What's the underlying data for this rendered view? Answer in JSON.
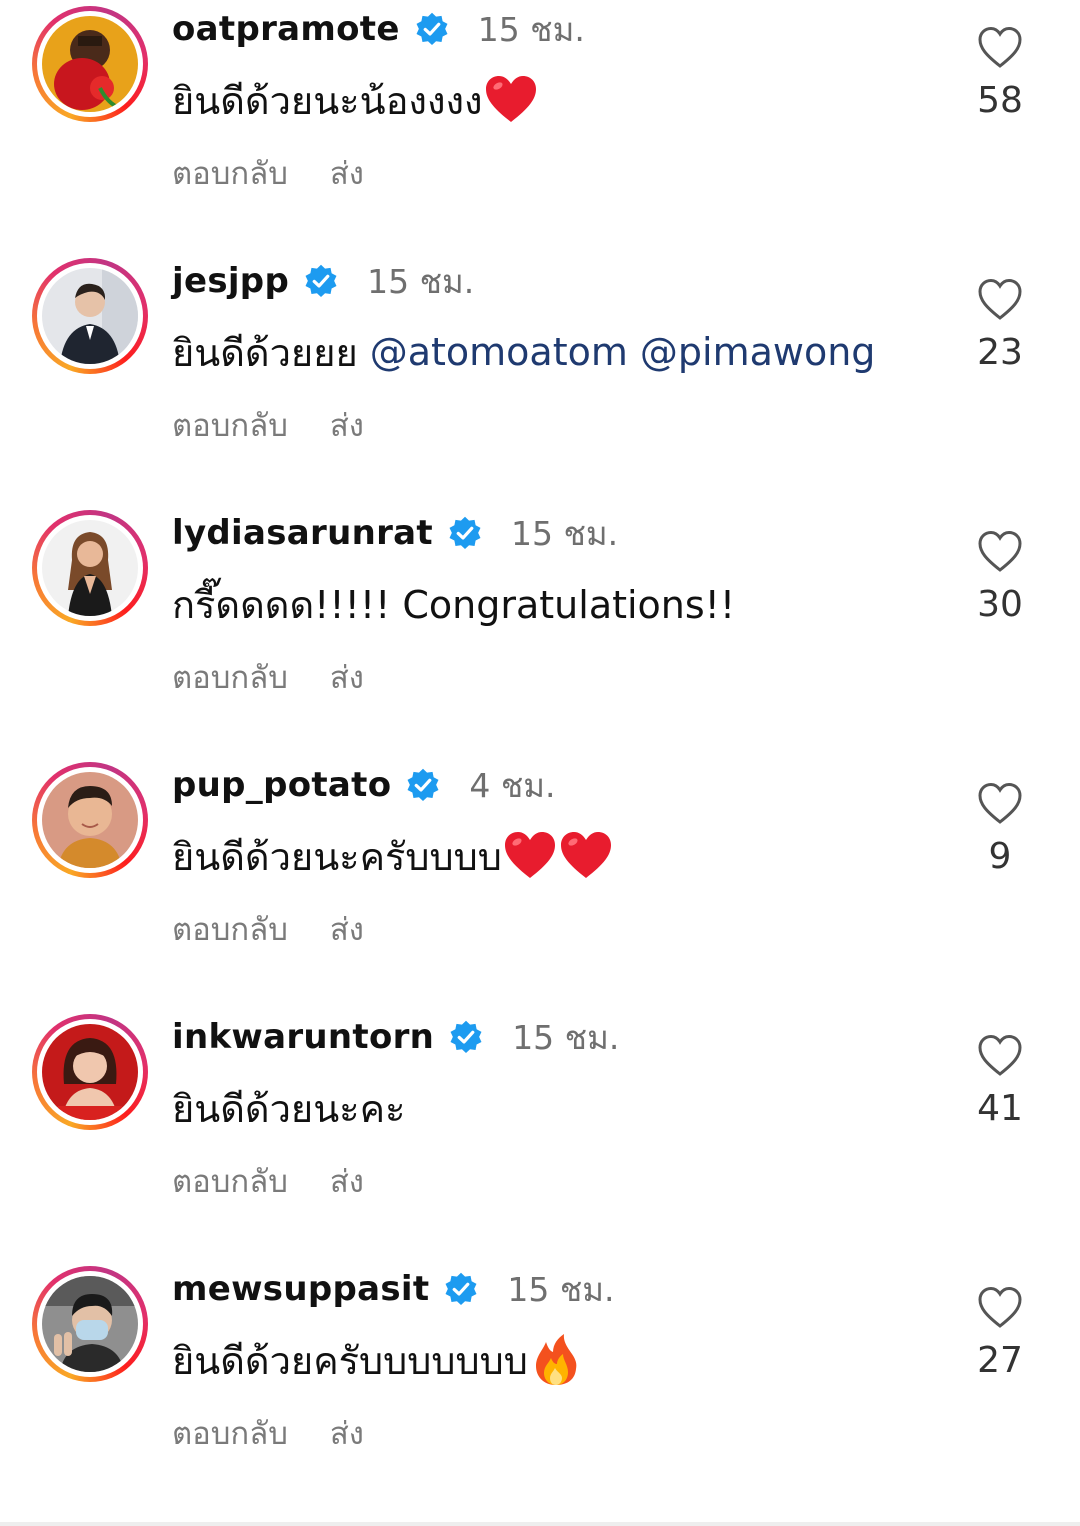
{
  "colors": {
    "verified": "#1d9bf0",
    "heart_emoji": "#e81c2e",
    "mention": "#1f3a70",
    "muted_text": "#7a7a7a"
  },
  "labels": {
    "reply": "ตอบกลับ",
    "send": "ส่ง"
  },
  "comments": [
    {
      "username": "oatpramote",
      "verified": true,
      "time": "15 ชม.",
      "text": "ยินดีด้วยนะน้องงงง",
      "emojis": [
        "red-heart"
      ],
      "likes": "58",
      "avatar_icon": "avatar-oatpramote"
    },
    {
      "username": "jesjpp",
      "verified": true,
      "time": "15 ชม.",
      "text": "ยินดีด้วยยย",
      "mentions": [
        "@atomoatom",
        "@pimawong"
      ],
      "likes": "23",
      "avatar_icon": "avatar-jesjpp"
    },
    {
      "username": "lydiasarunrat",
      "verified": true,
      "time": "15 ชม.",
      "text": "กรี๊ดดดด!!!!! Congratulations!!",
      "likes": "30",
      "avatar_icon": "avatar-lydiasarunrat"
    },
    {
      "username": "pup_potato",
      "verified": true,
      "time": "4 ชม.",
      "text": "ยินดีด้วยนะครับบบบ",
      "emojis": [
        "red-heart",
        "red-heart"
      ],
      "likes": "9",
      "avatar_icon": "avatar-pup_potato"
    },
    {
      "username": "inkwaruntorn",
      "verified": true,
      "time": "15 ชม.",
      "text": "ยินดีด้วยนะคะ",
      "likes": "41",
      "avatar_icon": "avatar-inkwaruntorn"
    },
    {
      "username": "mewsuppasit",
      "verified": true,
      "time": "15 ชม.",
      "text": "ยินดีด้วยครับบบบบบบ",
      "emojis": [
        "fire"
      ],
      "likes": "27",
      "avatar_icon": "avatar-mewsuppasit"
    }
  ]
}
